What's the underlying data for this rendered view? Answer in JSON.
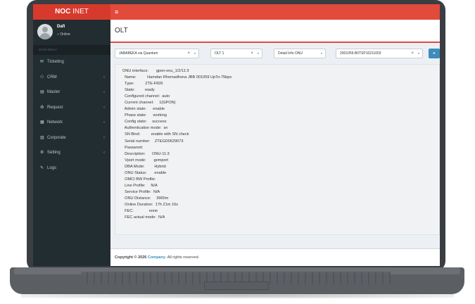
{
  "app": {
    "logo_bold": "NOC",
    "logo_thin": " INET",
    "menu_icon": "hamburger-icon"
  },
  "user": {
    "name": "Dafi",
    "status": "Online"
  },
  "sidebar": {
    "header": "MAIN MENU",
    "items": [
      {
        "label": "Ticketing",
        "icon": "envelope-icon",
        "chevron": false
      },
      {
        "label": "CRM",
        "icon": "users-icon",
        "chevron": true
      },
      {
        "label": "Master",
        "icon": "database-icon",
        "chevron": true
      },
      {
        "label": "Request",
        "icon": "recycle-icon",
        "chevron": true
      },
      {
        "label": "Network",
        "icon": "server-icon",
        "chevron": true
      },
      {
        "label": "Corporate",
        "icon": "building-icon",
        "chevron": true
      },
      {
        "label": "Setting",
        "icon": "gears-icon",
        "chevron": true
      },
      {
        "label": "Logs",
        "icon": "edit-icon",
        "chevron": false
      }
    ]
  },
  "page": {
    "title": "OLT"
  },
  "filters": {
    "site": "JABABEKA via Quantum",
    "olt": "OLT 1",
    "info_type": "Detail Info ONU",
    "onu": "2001059.B0TSP10211003"
  },
  "onu_info": [
    "ONU interface:       gpon-onu_1/2/11:3",
    "  Name:          Hamdan Rhomadhona JBB 001059 UpTo-75bps",
    "  Type:          ZTE-F609",
    "  State:         ready",
    "  Configured channel:  auto",
    "  Current channel:     1(GPON)",
    "  Admin state:      enable",
    "  Phase state:      working",
    "  Config state:     success",
    "  Authentication mode:  sn",
    "  SN Bind:          enable with SN check",
    "  Serial number:    ZTEGD0629073",
    "  Password:",
    "  Description:      ONU-11:3",
    "  Vport mode:       gemport",
    "  DBA Mode:         Hybrid",
    "  ONU Status:       enable",
    "  OMCI BW Profile:",
    "  Line Profile:     N/A",
    "  Service Profile:  N/A",
    "  ONU Distance:     3965m",
    "  Online Duration:  17h 21m 16s",
    "  FEC:              none",
    "  FEC actual mode:  N/A"
  ],
  "footer": {
    "prefix": "Copyright © 2026 ",
    "company": "Company",
    "suffix": ". All rights reserved."
  }
}
